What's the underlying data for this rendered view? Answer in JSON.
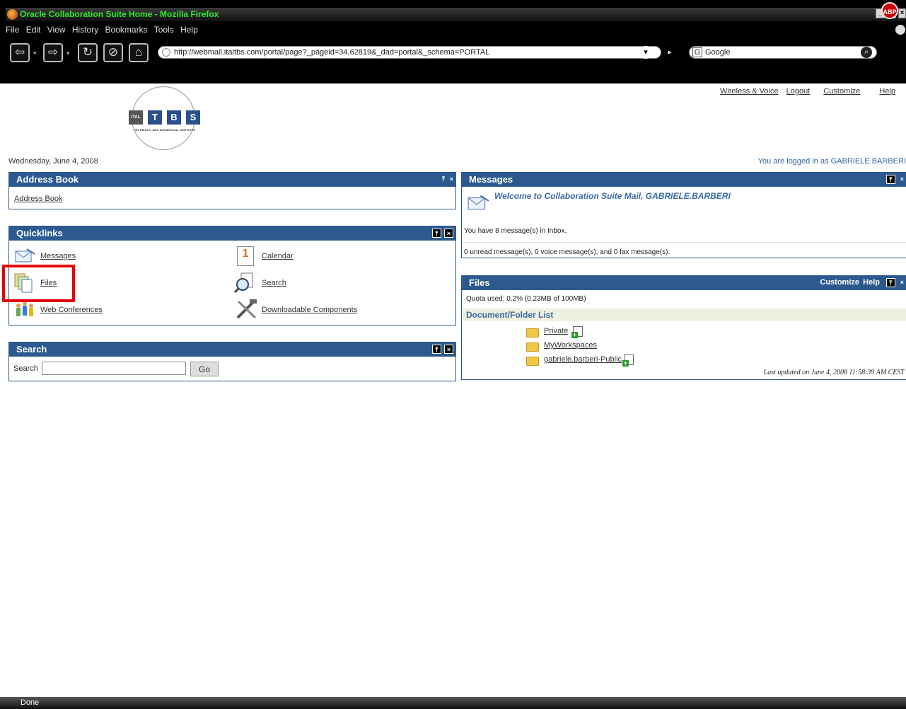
{
  "browser": {
    "window_title": "Oracle Collaboration Suite Home - Mozilla Firefox",
    "menu": [
      "File",
      "Edit",
      "View",
      "History",
      "Bookmarks",
      "Tools",
      "Help"
    ],
    "url": "http://webmail.italtbs.com/portal/page?_pageid=34,62819&_dad=portal&_schema=PORTAL",
    "search_engine": "Google",
    "adblock_label": "ABP",
    "status": "Done"
  },
  "header": {
    "links": [
      "Wireless & Voice",
      "Logout",
      "Customize",
      "Help"
    ],
    "logo": {
      "letters": [
        "ITAL",
        "T",
        "B",
        "S"
      ],
      "tagline": "TELEMATIC AND BIOMEDICAL SERVICES"
    },
    "date": "Wednesday, June 4, 2008",
    "logged_in": "You are logged in as GABRIELE.BARBERI"
  },
  "address_book": {
    "title": "Address Book",
    "link": "Address Book"
  },
  "quicklinks": {
    "title": "Quicklinks",
    "items": [
      {
        "label": "Messages",
        "icon": "messages-icon"
      },
      {
        "label": "Calendar",
        "icon": "calendar-icon"
      },
      {
        "label": "Files",
        "icon": "files-icon"
      },
      {
        "label": "Search",
        "icon": "search-icon"
      },
      {
        "label": "Web Conferences",
        "icon": "web-conferences-icon"
      },
      {
        "label": "Downloadable Components",
        "icon": "tools-icon"
      }
    ],
    "calendar_day": "1"
  },
  "search_portlet": {
    "title": "Search",
    "label": "Search",
    "input_value": "",
    "button": "Go"
  },
  "messages": {
    "title": "Messages",
    "welcome": "Welcome to Collaboration Suite Mail, GABRIELE.BARBERI",
    "inbox_line": "You have 8 message(s) in Inbox.",
    "summary_line": "0 unread message(s), 0 voice message(s), and 0 fax message(s)."
  },
  "files": {
    "title": "Files",
    "header_links": [
      "Customize",
      "Help"
    ],
    "quota": "Quota used: 0.2% (0.23MB of 100MB)",
    "list_header": "Document/Folder List",
    "folders": [
      "Private",
      "MyWorkspaces",
      "gabriele.barberi-Public"
    ],
    "last_updated": "Last updated on June 4, 2008 11:58:39 AM CEST"
  },
  "colors": {
    "portlet_header": "#2c5a8f",
    "highlight_box": "#e8000b",
    "title_text": "#2ee82e"
  }
}
